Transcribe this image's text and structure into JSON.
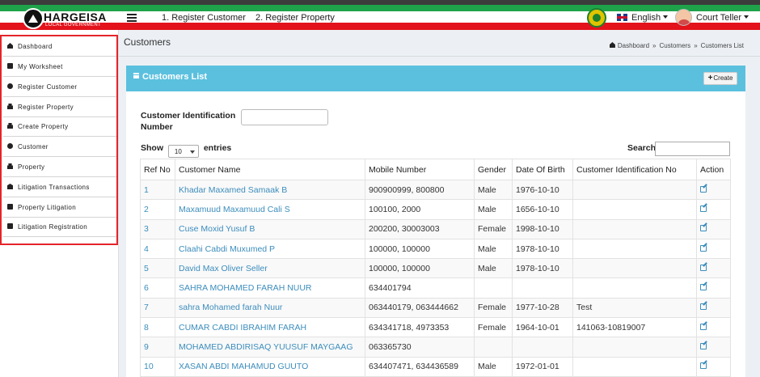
{
  "header": {
    "logo_title": "HARGEISA",
    "logo_subtitle": "LOCAL GOVERNMENT",
    "nav": [
      "1. Register Customer",
      "2. Register Property"
    ],
    "language": "English",
    "user": "Court Teller"
  },
  "sidebar": {
    "items": [
      {
        "label": "Dashboard",
        "icon": "home-icon"
      },
      {
        "label": "My Worksheet",
        "icon": "book-icon"
      },
      {
        "label": "Register Customer",
        "icon": "user-icon"
      },
      {
        "label": "Register Property",
        "icon": "lock-icon"
      },
      {
        "label": "Create Property",
        "icon": "lock-icon"
      },
      {
        "label": "Customer",
        "icon": "user-icon"
      },
      {
        "label": "Property",
        "icon": "lock-icon"
      },
      {
        "label": "Litigation Transactions",
        "icon": "bank-icon"
      },
      {
        "label": "Property Litigation",
        "icon": "book-icon"
      },
      {
        "label": "Litigation Registration",
        "icon": "book-icon"
      }
    ]
  },
  "page": {
    "title": "Customers",
    "breadcrumb": [
      "Dashboard",
      "Customers",
      "Customers List"
    ]
  },
  "panel": {
    "title": "Customers List",
    "create_label": "Create",
    "cid_label": "Customer Identification Number",
    "cid_value": "",
    "show_label": "Show",
    "entries_value": "10",
    "entries_label": "entries",
    "search_label": "Search:",
    "search_value": ""
  },
  "table": {
    "columns": [
      "Ref No",
      "Customer Name",
      "Mobile Number",
      "Gender",
      "Date Of Birth",
      "Customer Identification No",
      "Action"
    ],
    "rows": [
      {
        "ref": "1",
        "name": "Khadar Maxamed Samaak B",
        "mobile": "900900999, 800800",
        "gender": "Male",
        "dob": "1976-10-10",
        "cid": ""
      },
      {
        "ref": "2",
        "name": "Maxamuud Maxamuud Cali S",
        "mobile": "100100, 2000",
        "gender": "Male",
        "dob": "1656-10-10",
        "cid": ""
      },
      {
        "ref": "3",
        "name": "Cuse Moxid Yusuf B",
        "mobile": "200200, 30003003",
        "gender": "Female",
        "dob": "1998-10-10",
        "cid": ""
      },
      {
        "ref": "4",
        "name": "Claahi Cabdi Muxumed P",
        "mobile": "100000, 100000",
        "gender": "Male",
        "dob": "1978-10-10",
        "cid": ""
      },
      {
        "ref": "5",
        "name": "David Max Oliver Seller",
        "mobile": "100000, 100000",
        "gender": "Male",
        "dob": "1978-10-10",
        "cid": ""
      },
      {
        "ref": "6",
        "name": "SAHRA MOHAMED FARAH NUUR",
        "mobile": "634401794",
        "gender": "",
        "dob": "",
        "cid": ""
      },
      {
        "ref": "7",
        "name": "sahra Mohamed farah Nuur",
        "mobile": "063440179, 063444662",
        "gender": "Female",
        "dob": "1977-10-28",
        "cid": "Test"
      },
      {
        "ref": "8",
        "name": "CUMAR CABDI IBRAHIM FARAH",
        "mobile": "634341718, 4973353",
        "gender": "Female",
        "dob": "1964-10-01",
        "cid": "141063-10819007"
      },
      {
        "ref": "9",
        "name": "MOHAMED ABDIRISAQ YUUSUF MAYGAAG",
        "mobile": "063365730",
        "gender": "",
        "dob": "",
        "cid": ""
      },
      {
        "ref": "10",
        "name": "XASAN ABDI MAHAMUD GUUTO",
        "mobile": "634407471, 634436589",
        "gender": "Male",
        "dob": "1972-01-01",
        "cid": ""
      }
    ]
  }
}
